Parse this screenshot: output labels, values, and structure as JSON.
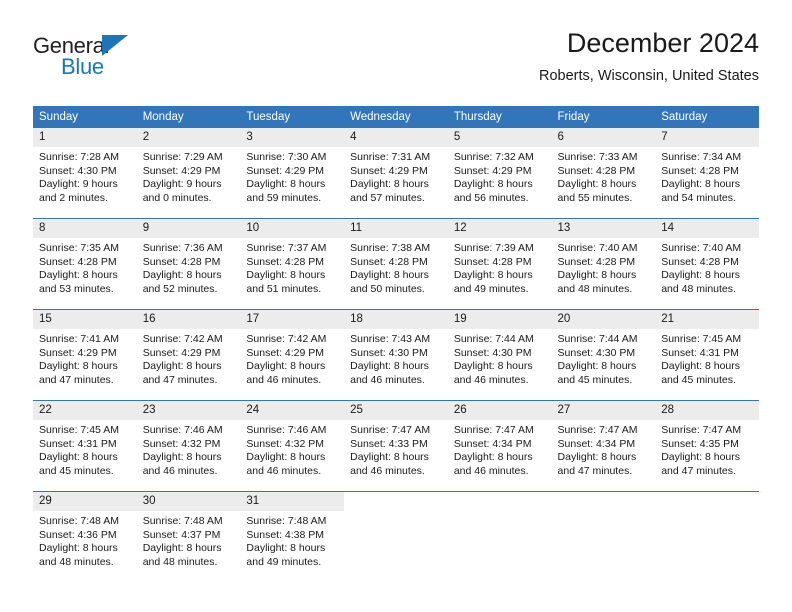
{
  "brand": {
    "name_top": "General",
    "name_bottom": "Blue",
    "triangle_color": "#1b75bb"
  },
  "header": {
    "title": "December 2024",
    "location": "Roberts, Wisconsin, United States"
  },
  "theme": {
    "header_bg": "#3275b8",
    "daynum_bg": "#ececec",
    "text": "#1a1a1a"
  },
  "weekday_headers": [
    "Sunday",
    "Monday",
    "Tuesday",
    "Wednesday",
    "Thursday",
    "Friday",
    "Saturday"
  ],
  "weeks": [
    [
      {
        "day": "1",
        "sunrise": "Sunrise: 7:28 AM",
        "sunset": "Sunset: 4:30 PM",
        "daylight_1": "Daylight: 9 hours",
        "daylight_2": "and 2 minutes."
      },
      {
        "day": "2",
        "sunrise": "Sunrise: 7:29 AM",
        "sunset": "Sunset: 4:29 PM",
        "daylight_1": "Daylight: 9 hours",
        "daylight_2": "and 0 minutes."
      },
      {
        "day": "3",
        "sunrise": "Sunrise: 7:30 AM",
        "sunset": "Sunset: 4:29 PM",
        "daylight_1": "Daylight: 8 hours",
        "daylight_2": "and 59 minutes."
      },
      {
        "day": "4",
        "sunrise": "Sunrise: 7:31 AM",
        "sunset": "Sunset: 4:29 PM",
        "daylight_1": "Daylight: 8 hours",
        "daylight_2": "and 57 minutes."
      },
      {
        "day": "5",
        "sunrise": "Sunrise: 7:32 AM",
        "sunset": "Sunset: 4:29 PM",
        "daylight_1": "Daylight: 8 hours",
        "daylight_2": "and 56 minutes."
      },
      {
        "day": "6",
        "sunrise": "Sunrise: 7:33 AM",
        "sunset": "Sunset: 4:28 PM",
        "daylight_1": "Daylight: 8 hours",
        "daylight_2": "and 55 minutes."
      },
      {
        "day": "7",
        "sunrise": "Sunrise: 7:34 AM",
        "sunset": "Sunset: 4:28 PM",
        "daylight_1": "Daylight: 8 hours",
        "daylight_2": "and 54 minutes."
      }
    ],
    [
      {
        "day": "8",
        "sunrise": "Sunrise: 7:35 AM",
        "sunset": "Sunset: 4:28 PM",
        "daylight_1": "Daylight: 8 hours",
        "daylight_2": "and 53 minutes."
      },
      {
        "day": "9",
        "sunrise": "Sunrise: 7:36 AM",
        "sunset": "Sunset: 4:28 PM",
        "daylight_1": "Daylight: 8 hours",
        "daylight_2": "and 52 minutes."
      },
      {
        "day": "10",
        "sunrise": "Sunrise: 7:37 AM",
        "sunset": "Sunset: 4:28 PM",
        "daylight_1": "Daylight: 8 hours",
        "daylight_2": "and 51 minutes."
      },
      {
        "day": "11",
        "sunrise": "Sunrise: 7:38 AM",
        "sunset": "Sunset: 4:28 PM",
        "daylight_1": "Daylight: 8 hours",
        "daylight_2": "and 50 minutes."
      },
      {
        "day": "12",
        "sunrise": "Sunrise: 7:39 AM",
        "sunset": "Sunset: 4:28 PM",
        "daylight_1": "Daylight: 8 hours",
        "daylight_2": "and 49 minutes."
      },
      {
        "day": "13",
        "sunrise": "Sunrise: 7:40 AM",
        "sunset": "Sunset: 4:28 PM",
        "daylight_1": "Daylight: 8 hours",
        "daylight_2": "and 48 minutes."
      },
      {
        "day": "14",
        "sunrise": "Sunrise: 7:40 AM",
        "sunset": "Sunset: 4:28 PM",
        "daylight_1": "Daylight: 8 hours",
        "daylight_2": "and 48 minutes."
      }
    ],
    [
      {
        "day": "15",
        "sunrise": "Sunrise: 7:41 AM",
        "sunset": "Sunset: 4:29 PM",
        "daylight_1": "Daylight: 8 hours",
        "daylight_2": "and 47 minutes."
      },
      {
        "day": "16",
        "sunrise": "Sunrise: 7:42 AM",
        "sunset": "Sunset: 4:29 PM",
        "daylight_1": "Daylight: 8 hours",
        "daylight_2": "and 47 minutes."
      },
      {
        "day": "17",
        "sunrise": "Sunrise: 7:42 AM",
        "sunset": "Sunset: 4:29 PM",
        "daylight_1": "Daylight: 8 hours",
        "daylight_2": "and 46 minutes."
      },
      {
        "day": "18",
        "sunrise": "Sunrise: 7:43 AM",
        "sunset": "Sunset: 4:30 PM",
        "daylight_1": "Daylight: 8 hours",
        "daylight_2": "and 46 minutes."
      },
      {
        "day": "19",
        "sunrise": "Sunrise: 7:44 AM",
        "sunset": "Sunset: 4:30 PM",
        "daylight_1": "Daylight: 8 hours",
        "daylight_2": "and 46 minutes."
      },
      {
        "day": "20",
        "sunrise": "Sunrise: 7:44 AM",
        "sunset": "Sunset: 4:30 PM",
        "daylight_1": "Daylight: 8 hours",
        "daylight_2": "and 45 minutes."
      },
      {
        "day": "21",
        "sunrise": "Sunrise: 7:45 AM",
        "sunset": "Sunset: 4:31 PM",
        "daylight_1": "Daylight: 8 hours",
        "daylight_2": "and 45 minutes."
      }
    ],
    [
      {
        "day": "22",
        "sunrise": "Sunrise: 7:45 AM",
        "sunset": "Sunset: 4:31 PM",
        "daylight_1": "Daylight: 8 hours",
        "daylight_2": "and 45 minutes."
      },
      {
        "day": "23",
        "sunrise": "Sunrise: 7:46 AM",
        "sunset": "Sunset: 4:32 PM",
        "daylight_1": "Daylight: 8 hours",
        "daylight_2": "and 46 minutes."
      },
      {
        "day": "24",
        "sunrise": "Sunrise: 7:46 AM",
        "sunset": "Sunset: 4:32 PM",
        "daylight_1": "Daylight: 8 hours",
        "daylight_2": "and 46 minutes."
      },
      {
        "day": "25",
        "sunrise": "Sunrise: 7:47 AM",
        "sunset": "Sunset: 4:33 PM",
        "daylight_1": "Daylight: 8 hours",
        "daylight_2": "and 46 minutes."
      },
      {
        "day": "26",
        "sunrise": "Sunrise: 7:47 AM",
        "sunset": "Sunset: 4:34 PM",
        "daylight_1": "Daylight: 8 hours",
        "daylight_2": "and 46 minutes."
      },
      {
        "day": "27",
        "sunrise": "Sunrise: 7:47 AM",
        "sunset": "Sunset: 4:34 PM",
        "daylight_1": "Daylight: 8 hours",
        "daylight_2": "and 47 minutes."
      },
      {
        "day": "28",
        "sunrise": "Sunrise: 7:47 AM",
        "sunset": "Sunset: 4:35 PM",
        "daylight_1": "Daylight: 8 hours",
        "daylight_2": "and 47 minutes."
      }
    ],
    [
      {
        "day": "29",
        "sunrise": "Sunrise: 7:48 AM",
        "sunset": "Sunset: 4:36 PM",
        "daylight_1": "Daylight: 8 hours",
        "daylight_2": "and 48 minutes."
      },
      {
        "day": "30",
        "sunrise": "Sunrise: 7:48 AM",
        "sunset": "Sunset: 4:37 PM",
        "daylight_1": "Daylight: 8 hours",
        "daylight_2": "and 48 minutes."
      },
      {
        "day": "31",
        "sunrise": "Sunrise: 7:48 AM",
        "sunset": "Sunset: 4:38 PM",
        "daylight_1": "Daylight: 8 hours",
        "daylight_2": "and 49 minutes."
      },
      {
        "day": "",
        "sunrise": "",
        "sunset": "",
        "daylight_1": "",
        "daylight_2": ""
      },
      {
        "day": "",
        "sunrise": "",
        "sunset": "",
        "daylight_1": "",
        "daylight_2": ""
      },
      {
        "day": "",
        "sunrise": "",
        "sunset": "",
        "daylight_1": "",
        "daylight_2": ""
      },
      {
        "day": "",
        "sunrise": "",
        "sunset": "",
        "daylight_1": "",
        "daylight_2": ""
      }
    ]
  ]
}
